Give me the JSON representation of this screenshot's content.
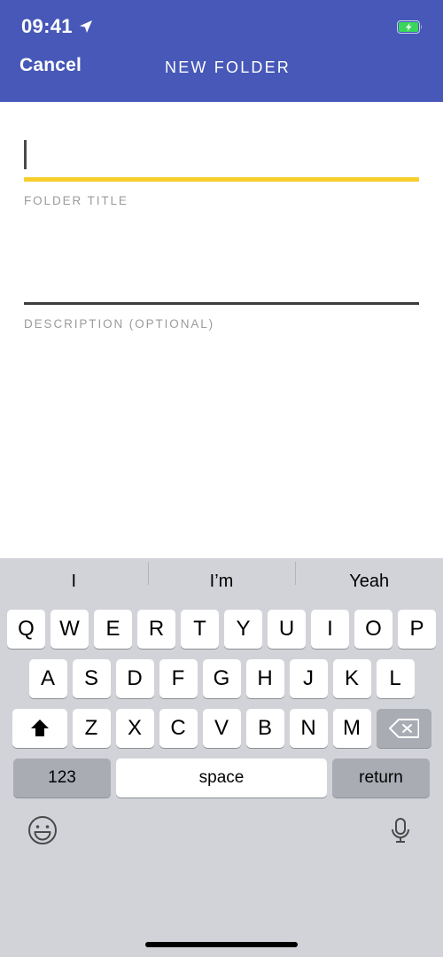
{
  "status_bar": {
    "time": "09:41",
    "location_icon": "location-arrow-icon",
    "battery_icon": "battery-charging-icon",
    "battery_charging": true
  },
  "nav": {
    "cancel_label": "Cancel",
    "title": "NEW FOLDER"
  },
  "form": {
    "title_field": {
      "value": "",
      "label": "FOLDER TITLE",
      "focused": true,
      "underline_color": "#F7CE2C"
    },
    "description_field": {
      "value": "",
      "label": "DESCRIPTION (OPTIONAL)",
      "focused": false,
      "underline_color": "#3D3D3D"
    }
  },
  "keyboard": {
    "suggestions": [
      "I",
      "I’m",
      "Yeah"
    ],
    "row1": [
      "Q",
      "W",
      "E",
      "R",
      "T",
      "Y",
      "U",
      "I",
      "O",
      "P"
    ],
    "row2": [
      "A",
      "S",
      "D",
      "F",
      "G",
      "H",
      "J",
      "K",
      "L"
    ],
    "row3": [
      "Z",
      "X",
      "C",
      "V",
      "B",
      "N",
      "M"
    ],
    "shift_key": "shift-icon",
    "backspace_key": "backspace-icon",
    "numeric_label": "123",
    "space_label": "space",
    "return_label": "return",
    "emoji_key": "emoji-smiley-icon",
    "mic_key": "microphone-icon",
    "shift_active": true
  },
  "colors": {
    "header_blue": "#4758B8",
    "accent_yellow": "#F7CE2C",
    "keyboard_bg": "#D1D3D9",
    "key_white": "#FFFFFF",
    "key_gray": "#AAACB4",
    "label_gray": "#9B9B9B"
  }
}
